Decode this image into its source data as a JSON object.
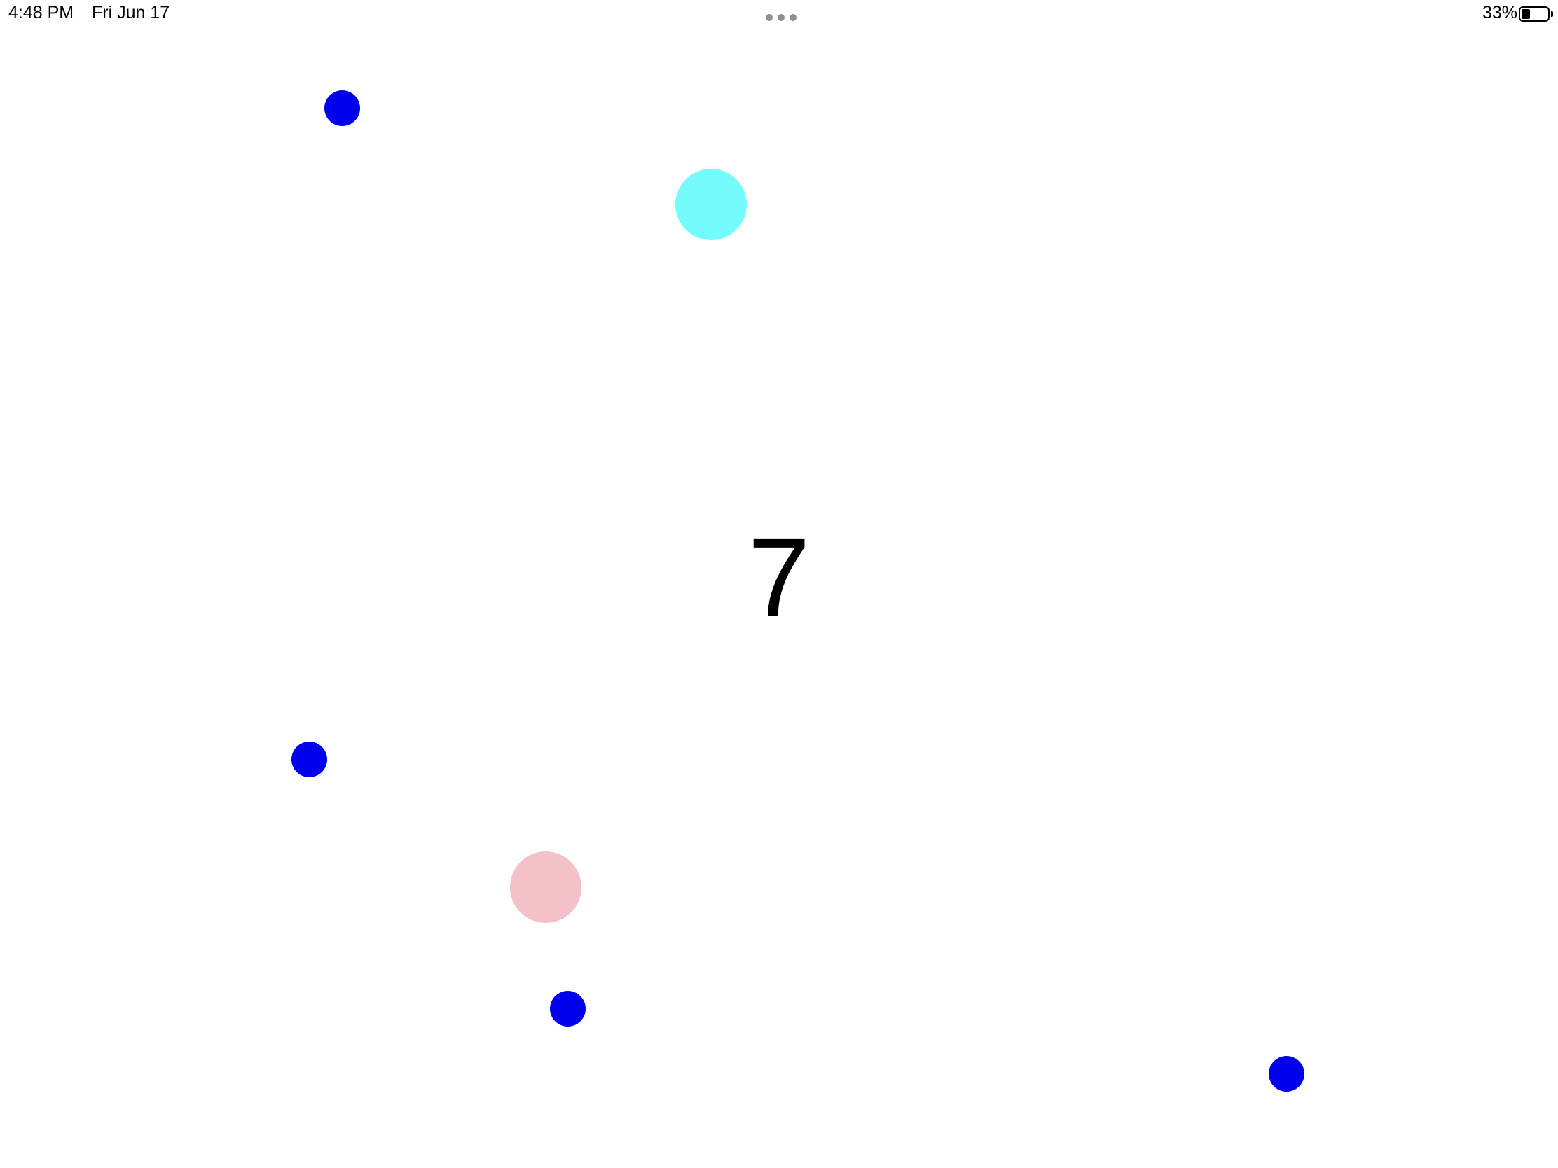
{
  "status_bar": {
    "time": "4:48 PM",
    "date": "Fri Jun 17",
    "battery_percent": "33%",
    "battery_level": 0.33,
    "multitask_icon": "ellipsis-icon"
  },
  "game": {
    "counter": "7",
    "colors": {
      "blue": "#0000ee",
      "cyan": "#74fcfc",
      "pink": "#f4c1c9"
    },
    "dots": [
      {
        "id": "dot-blue-1",
        "color": "blue"
      },
      {
        "id": "dot-cyan",
        "color": "cyan"
      },
      {
        "id": "dot-blue-2",
        "color": "blue"
      },
      {
        "id": "dot-pink",
        "color": "pink"
      },
      {
        "id": "dot-blue-3",
        "color": "blue"
      },
      {
        "id": "dot-blue-4",
        "color": "blue"
      }
    ]
  }
}
